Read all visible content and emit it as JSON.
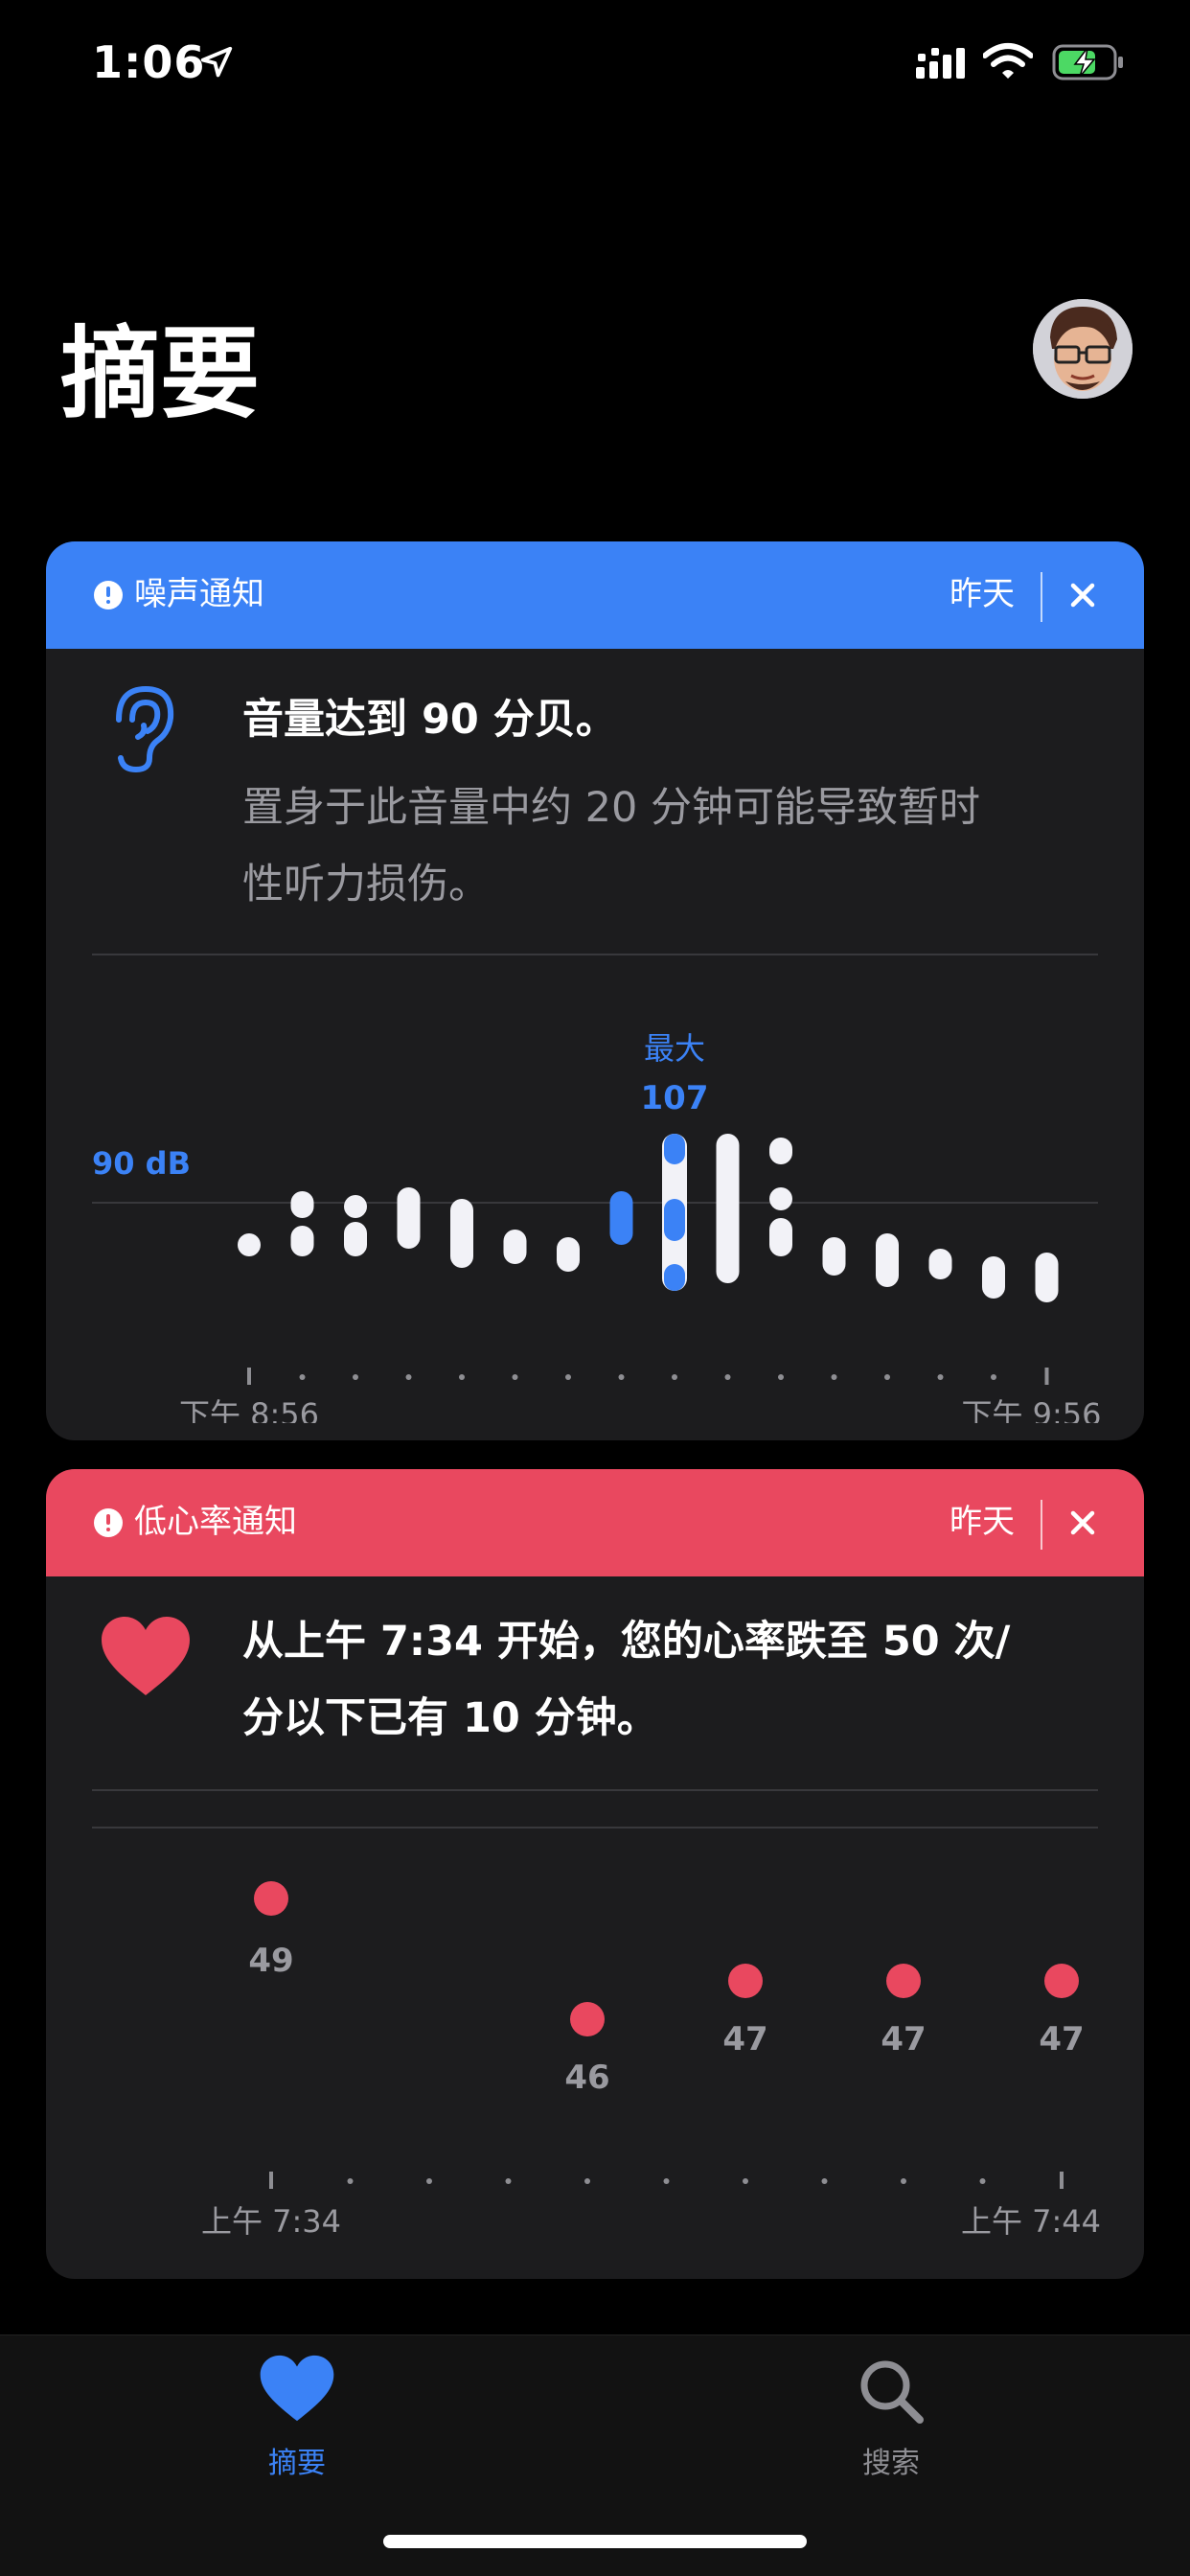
{
  "status_bar": {
    "time": "1:06"
  },
  "page": {
    "title": "摘要"
  },
  "noise_card": {
    "header_title": "噪声通知",
    "header_when": "昨天",
    "message_title": "音量达到 90 分贝。",
    "message_body_line1": "置身于此音量中约 20 分钟可能导致暂时",
    "message_body_line2": "性听力损伤。",
    "colors": {
      "header": "#3b82f6",
      "accent": "#3b82f6"
    }
  },
  "heart_card": {
    "header_title": "低心率通知",
    "header_when": "昨天",
    "message_line1": "从上午 7:34 开始，您的心率跌至 50 次/",
    "message_line2": "分以下已有 10 分钟。",
    "colors": {
      "header": "#e9485f",
      "accent": "#e9485f"
    }
  },
  "chart_data": [
    {
      "type": "bar",
      "title": "",
      "threshold_label": "90 dB",
      "threshold_value": 90,
      "max_label": "最大",
      "max_value": "107",
      "x_start_label": "下午 8:56",
      "x_end_label": "下午 9:56",
      "ylim": [
        60,
        110
      ],
      "bars": [
        {
          "segments": [
            [
              76,
              82
            ]
          ]
        },
        {
          "segments": [
            [
              86,
              93
            ],
            [
              76,
              84
            ]
          ]
        },
        {
          "segments": [
            [
              87,
              92
            ],
            [
              76,
              85
            ]
          ]
        },
        {
          "segments": [
            [
              78,
              94
            ]
          ]
        },
        {
          "segments": [
            [
              73,
              91
            ]
          ]
        },
        {
          "segments": [
            [
              74,
              83
            ]
          ]
        },
        {
          "segments": [
            [
              72,
              81
            ]
          ]
        },
        {
          "segments": [
            [
              79,
              93
            ]
          ],
          "highlight": true
        },
        {
          "segments": [
            [
              100,
              108
            ],
            [
              80,
              91
            ],
            [
              67,
              74
            ]
          ],
          "highlight": true,
          "outline": true
        },
        {
          "segments": [
            [
              69,
              108
            ]
          ]
        },
        {
          "segments": [
            [
              100,
              107
            ],
            [
              88,
              94
            ],
            [
              76,
              86
            ]
          ]
        },
        {
          "segments": [
            [
              71,
              81
            ]
          ]
        },
        {
          "segments": [
            [
              68,
              82
            ]
          ]
        },
        {
          "segments": [
            [
              70,
              78
            ]
          ]
        },
        {
          "segments": [
            [
              65,
              76
            ]
          ]
        },
        {
          "segments": [
            [
              64,
              77
            ]
          ]
        }
      ]
    },
    {
      "type": "scatter",
      "title": "",
      "x_start_label": "上午 7:34",
      "x_end_label": "上午 7:44",
      "ylim": [
        44,
        51
      ],
      "points": [
        {
          "x": 0,
          "value": 49,
          "label": "49",
          "range": [
            48.7,
            49.6
          ]
        },
        {
          "x": 4,
          "value": 46,
          "label": "46"
        },
        {
          "x": 6,
          "value": 47,
          "label": "47"
        },
        {
          "x": 8,
          "value": 47,
          "label": "47"
        },
        {
          "x": 10,
          "value": 47,
          "label": "47"
        }
      ]
    }
  ],
  "tab_bar": {
    "summary_label": "摘要",
    "search_label": "搜索",
    "active_color": "#3b82f6",
    "inactive_color": "#8e8e93"
  }
}
